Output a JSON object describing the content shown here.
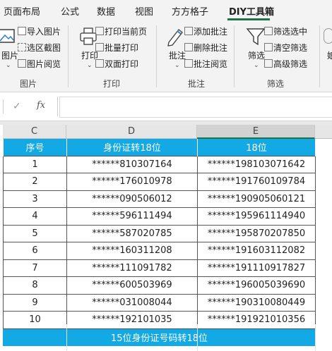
{
  "menu": {
    "tabs": [
      "页面布局",
      "公式",
      "数据",
      "视图",
      "方方格子",
      "DIY工具箱"
    ],
    "active_tab": "DIY工具箱"
  },
  "ribbon": {
    "image_group": {
      "big_button": "图片",
      "items": [
        "导入图片",
        "选区截图",
        "图片阅览"
      ],
      "label": "图片"
    },
    "print_group": {
      "big_button": "打印",
      "items": [
        "打印当前页",
        "批量打印",
        "双面打印"
      ],
      "label": "打印"
    },
    "comment_group": {
      "big_button": "批注",
      "items": [
        "添加批注",
        "删除批注",
        "批注阅览"
      ],
      "label": "批注"
    },
    "filter_group": {
      "big_button": "筛选",
      "items": [
        "筛选选中",
        "清空筛选",
        "高级筛选"
      ],
      "label": "筛选"
    },
    "cut_label": "娘"
  },
  "formula_bar": {
    "cancel_icon": "✓",
    "fx": "fx",
    "value": ""
  },
  "columns": [
    "C",
    "D",
    "E"
  ],
  "table": {
    "headers": [
      "序号",
      "身份证转18位",
      "18位"
    ],
    "rows": [
      [
        "1",
        "******810307164",
        "******198103071642"
      ],
      [
        "2",
        "******176010978",
        "******191760109784"
      ],
      [
        "3",
        "******090506012",
        "******190905060121"
      ],
      [
        "4",
        "******596111494",
        "******195961114940"
      ],
      [
        "5",
        "******587020785",
        "******195870207850"
      ],
      [
        "6",
        "******160311208",
        "******191603112082"
      ],
      [
        "7",
        "******111091782",
        "******191110917827"
      ],
      [
        "8",
        "******600503969",
        "******196005039690"
      ],
      [
        "9",
        "******031008044",
        "******190310080449"
      ],
      [
        "10",
        "******192101035",
        "******191921010356"
      ]
    ],
    "footer": "15位身份证号码转18位"
  },
  "colors": {
    "header_fill": "#12a9e4",
    "accent": "#217346"
  }
}
